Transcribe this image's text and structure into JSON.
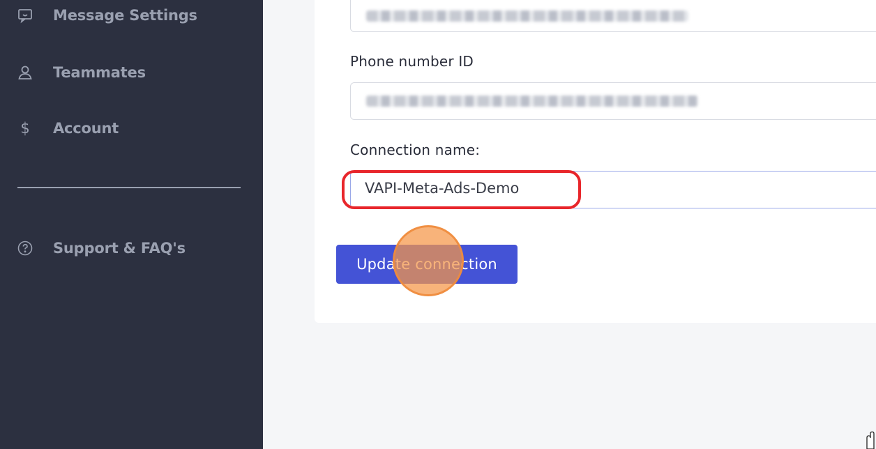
{
  "sidebar": {
    "items": [
      {
        "icon": "message-bubble-icon",
        "label": "Message Settings"
      },
      {
        "icon": "person-icon",
        "label": "Teammates"
      },
      {
        "icon": "dollar-icon",
        "label": "Account"
      },
      {
        "icon": "question-circle-icon",
        "label": "Support & FAQ's"
      }
    ]
  },
  "form": {
    "phone_number_id": {
      "label": "Phone number ID"
    },
    "connection_name": {
      "label": "Connection name:",
      "value": "VAPI-Meta-Ads-Demo"
    },
    "submit_label": "Update connection"
  },
  "colors": {
    "sidebar_bg": "#2c3040",
    "accent": "#4453d6",
    "highlight": "#e8262b",
    "click_marker": "#f59646"
  }
}
